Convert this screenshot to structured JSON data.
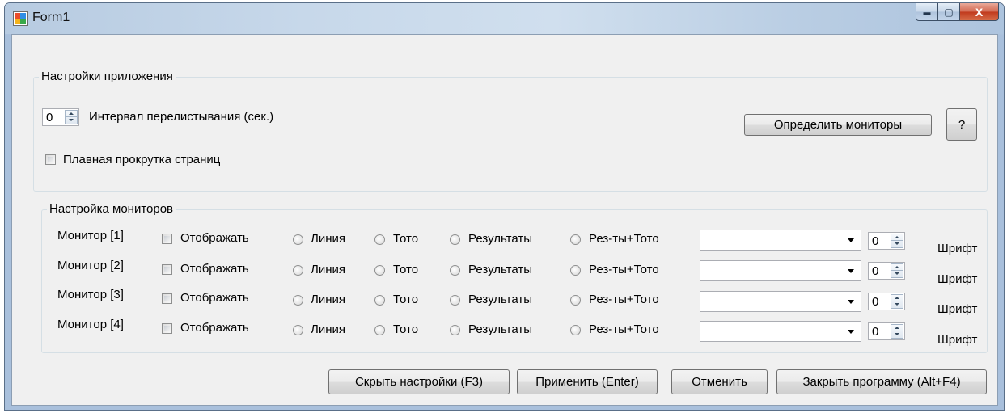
{
  "window": {
    "title": "Form1",
    "minimize": "▬",
    "maximize": "▢",
    "close": "X"
  },
  "app_settings": {
    "legend": "Настройки приложения",
    "interval_value": "0",
    "interval_label": "Интервал перелистывания (сек.)",
    "smooth_scroll_label": "Плавная прокрутка страниц",
    "smooth_scroll_checked": false,
    "detect_monitors_label": "Определить мониторы",
    "help_label": "?"
  },
  "monitor_settings": {
    "legend": "Настройка мониторов",
    "rows": [
      {
        "label": "Монитор [1]",
        "show": "Отображать",
        "line": "Линия",
        "toto": "Тото",
        "results": "Результаты",
        "results_toto": "Рез-ты+Тото",
        "combo_value": "",
        "font_value": "0",
        "font_label": "Шрифт"
      },
      {
        "label": "Монитор [2]",
        "show": "Отображать",
        "line": "Линия",
        "toto": "Тото",
        "results": "Результаты",
        "results_toto": "Рез-ты+Тото",
        "combo_value": "",
        "font_value": "0",
        "font_label": "Шрифт"
      },
      {
        "label": "Монитор [3]",
        "show": "Отображать",
        "line": "Линия",
        "toto": "Тото",
        "results": "Результаты",
        "results_toto": "Рез-ты+Тото",
        "combo_value": "",
        "font_value": "0",
        "font_label": "Шрифт"
      },
      {
        "label": "Монитор [4]",
        "show": "Отображать",
        "line": "Линия",
        "toto": "Тото",
        "results": "Результаты",
        "results_toto": "Рез-ты+Тото",
        "combo_value": "",
        "font_value": "0",
        "font_label": "Шрифт"
      }
    ]
  },
  "footer": {
    "hide_settings": "Скрыть настройки (F3)",
    "apply": "Применить (Enter)",
    "cancel": "Отменить",
    "close_program": "Закрыть программу (Alt+F4)"
  }
}
